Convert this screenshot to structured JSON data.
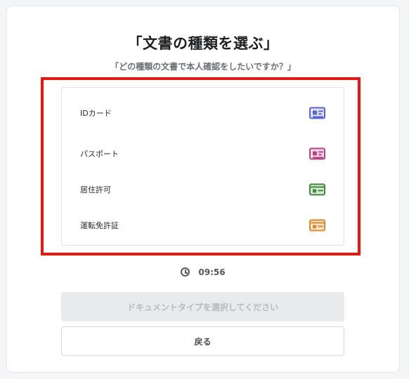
{
  "page": {
    "title": "「文書の種類を選ぶ」",
    "subtitle": "「どの種類の文書で本人確認をしたいですか？」"
  },
  "documents": [
    {
      "label": "IDカード",
      "icon": "id-card-icon",
      "color": "#5b63d8",
      "fill": "#dfe2fb"
    },
    {
      "label": "パスポート",
      "icon": "passport-icon",
      "color": "#b8447f",
      "fill": "#f6d9e8"
    },
    {
      "label": "居住許可",
      "icon": "residence-permit-icon",
      "color": "#3f8a3c",
      "fill": "#d5ecd2"
    },
    {
      "label": "運転免許証",
      "icon": "drivers-license-icon",
      "color": "#d98a2c",
      "fill": "#fbe6c8"
    }
  ],
  "timer": {
    "value": "09:56",
    "icon": "clock-icon"
  },
  "buttons": {
    "primary_label": "ドキュメントタイプを選択してください",
    "back_label": "戻る"
  },
  "colors": {
    "highlight_border": "#e8170f",
    "disabled_bg": "#e9eaeb"
  }
}
